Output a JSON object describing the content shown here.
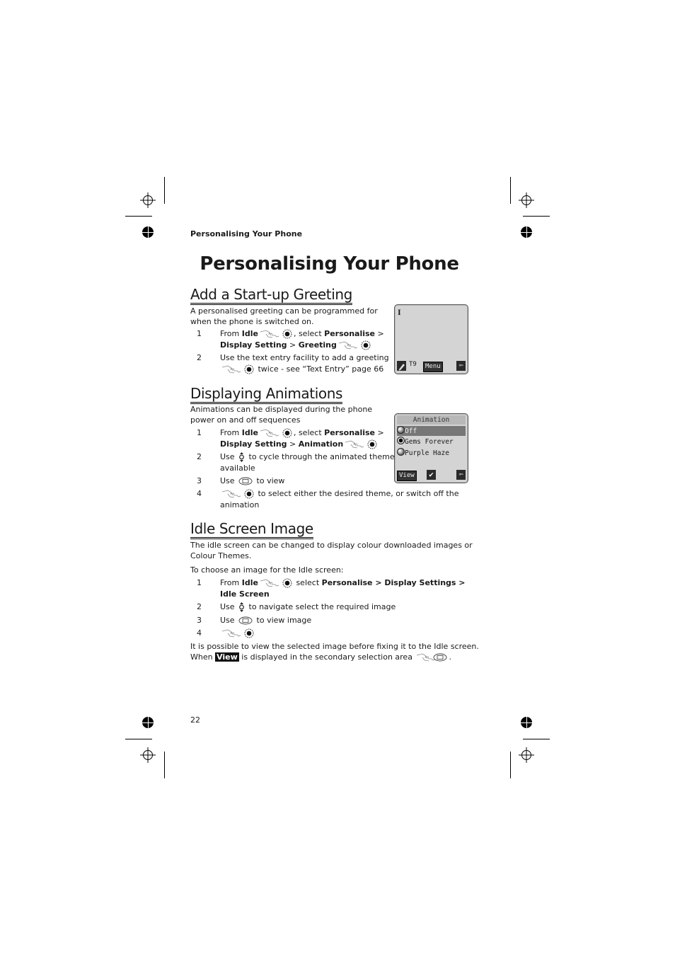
{
  "running_head": "Personalising Your Phone",
  "page_title": "Personalising Your Phone",
  "page_number": "22",
  "icons": {
    "hand": "hand-softkey-icon",
    "ok": "ok-select-button-icon",
    "nav": "up-down-navigation-icon",
    "soft": "secondary-softkey-icon"
  },
  "sections": {
    "greeting": {
      "heading": "Add a Start-up Greeting",
      "intro_1": "A personalised greeting can be programmed for",
      "intro_2": "when the phone is switched on.",
      "steps": [
        {
          "num": "1",
          "l1_a": "From ",
          "l1_b": "Idle",
          "l1_c": ", select ",
          "l1_d": "Personalise",
          "l1_e": " >",
          "l2_a": "Display Setting",
          "l2_b": " > ",
          "l2_c": "Greeting"
        },
        {
          "num": "2",
          "l1": "Use the text entry facility to add a greeting",
          "l2": " twice - see “Text Entry” page 66"
        }
      ],
      "screen": {
        "cursor": "I",
        "t9_label": "T9",
        "menu_label": "Menu",
        "back_glyph": "⇦"
      }
    },
    "animations": {
      "heading": "Displaying Animations",
      "intro_1": "Animations can be displayed during the phone",
      "intro_2": "power on and off sequences",
      "steps": [
        {
          "num": "1",
          "l1_a": "From ",
          "l1_b": "Idle",
          "l1_c": ", select ",
          "l1_d": "Personalise",
          "l1_e": " >",
          "l2_a": "Display Setting",
          "l2_b": " > ",
          "l2_c": "Animation"
        },
        {
          "num": "2",
          "l1_a": "Use ",
          "l1_b": " to cycle through the animated themes",
          "l2": "available"
        },
        {
          "num": "3",
          "l1_a": "Use ",
          "l1_b": " to view"
        },
        {
          "num": "4",
          "l1": " to select either the desired theme, or switch off the",
          "l2": "animation"
        }
      ],
      "screen": {
        "title": "Animation",
        "options": [
          {
            "label": "Off",
            "highlighted": true,
            "selected": false
          },
          {
            "label": "Gems Forever",
            "highlighted": false,
            "selected": true
          },
          {
            "label": "Purple Haze",
            "highlighted": false,
            "selected": false
          }
        ],
        "view_label": "View",
        "check_glyph": "✔",
        "back_glyph": "⇦"
      }
    },
    "idle": {
      "heading": "Idle Screen Image",
      "intro_1": "The idle screen can be changed to display colour downloaded images or",
      "intro_2": "Colour Themes.",
      "choose": "To choose an image for the Idle screen:",
      "steps": [
        {
          "num": "1",
          "l1_a": "From ",
          "l1_b": "Idle",
          "l1_c": " select ",
          "l1_d": "Personalise > Display Settings >",
          "l2": "Idle Screen"
        },
        {
          "num": "2",
          "l1_a": "Use ",
          "l1_b": " to navigate select the required image"
        },
        {
          "num": "3",
          "l1_a": "Use ",
          "l1_b": " to view image"
        },
        {
          "num": "4"
        }
      ],
      "note_1": "It is possible to view the selected image before fixing it to the Idle screen.",
      "note_2_a": "When ",
      "note_2_chip": "View",
      "note_2_b": " is displayed in the secondary selection area ",
      "note_2_c": "."
    }
  }
}
